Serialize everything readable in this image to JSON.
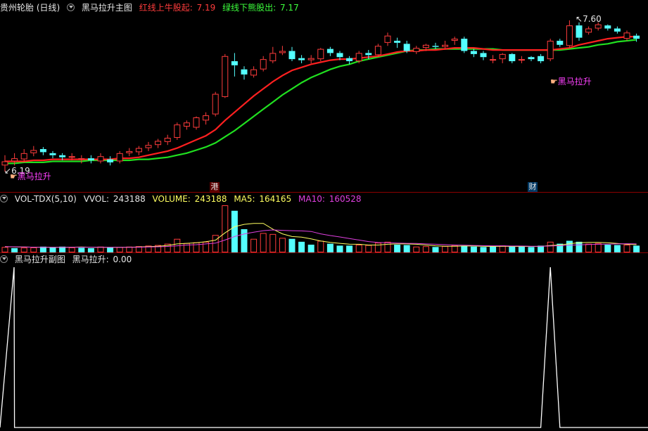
{
  "main": {
    "stock": "贵州轮胎 (日线)",
    "indicator": "黑马拉升主图",
    "red_line_label": "红线上牛股起:",
    "red_line_value": "7.19",
    "green_line_label": "绿线下熊股出:",
    "green_line_value": "7.17",
    "high_label": "7.60",
    "low_label": "6.19",
    "signal_text": "黑马拉升",
    "markers": [
      "港",
      "财"
    ]
  },
  "volume_panel": {
    "name": "VOL-TDX(5,10)",
    "vvol_label": "VVOL:",
    "vvol_value": "243188",
    "volume_label": "VOLUME:",
    "volume_value": "243188",
    "ma5_label": "MA5:",
    "ma5_value": "164165",
    "ma10_label": "MA10:",
    "ma10_value": "160528"
  },
  "sub_panel": {
    "name": "黑马拉升副图",
    "value_label": "黑马拉升:",
    "value": "0.00"
  },
  "colors": {
    "up": "#ff3c3c",
    "down": "#54ffff",
    "red_line": "#ff2020",
    "green_line": "#20e020",
    "ma5": "#ffff60",
    "ma10": "#e040e0",
    "signal": "#ff40ff",
    "separator": "#8b0000"
  },
  "candles": [
    [
      6.18,
      6.22,
      6.12,
      6.28
    ],
    [
      6.22,
      6.25,
      6.18,
      6.3
    ],
    [
      6.24,
      6.3,
      6.21,
      6.34
    ],
    [
      6.3,
      6.33,
      6.27,
      6.37
    ],
    [
      6.34,
      6.31,
      6.28,
      6.36
    ],
    [
      6.3,
      6.28,
      6.25,
      6.32
    ],
    [
      6.28,
      6.26,
      6.23,
      6.3
    ],
    [
      6.26,
      6.27,
      6.23,
      6.3
    ],
    [
      6.24,
      6.25,
      6.2,
      6.28
    ],
    [
      6.25,
      6.23,
      6.2,
      6.28
    ],
    [
      6.22,
      6.27,
      6.2,
      6.3
    ],
    [
      6.24,
      6.21,
      6.18,
      6.27
    ],
    [
      6.22,
      6.3,
      6.2,
      6.32
    ],
    [
      6.3,
      6.32,
      6.27,
      6.35
    ],
    [
      6.31,
      6.35,
      6.28,
      6.37
    ],
    [
      6.35,
      6.38,
      6.32,
      6.41
    ],
    [
      6.38,
      6.42,
      6.35,
      6.44
    ],
    [
      6.41,
      6.45,
      6.38,
      6.48
    ],
    [
      6.45,
      6.58,
      6.43,
      6.6
    ],
    [
      6.56,
      6.6,
      6.53,
      6.62
    ],
    [
      6.55,
      6.65,
      6.53,
      6.66
    ],
    [
      6.62,
      6.67,
      6.58,
      6.7
    ],
    [
      6.68,
      6.88,
      6.66,
      6.9
    ],
    [
      6.85,
      7.25,
      6.84,
      7.27
    ],
    [
      7.2,
      7.16,
      7.05,
      7.28
    ],
    [
      7.12,
      7.07,
      7.02,
      7.15
    ],
    [
      7.06,
      7.12,
      7.04,
      7.15
    ],
    [
      7.12,
      7.22,
      7.1,
      7.25
    ],
    [
      7.2,
      7.28,
      7.18,
      7.34
    ],
    [
      7.28,
      7.3,
      7.26,
      7.35
    ],
    [
      7.3,
      7.22,
      7.2,
      7.34
    ],
    [
      7.23,
      7.21,
      7.18,
      7.26
    ],
    [
      7.21,
      7.23,
      7.18,
      7.26
    ],
    [
      7.22,
      7.32,
      7.2,
      7.33
    ],
    [
      7.32,
      7.28,
      7.25,
      7.34
    ],
    [
      7.28,
      7.24,
      7.21,
      7.3
    ],
    [
      7.23,
      7.2,
      7.17,
      7.25
    ],
    [
      7.2,
      7.28,
      7.18,
      7.3
    ],
    [
      7.28,
      7.26,
      7.22,
      7.31
    ],
    [
      7.26,
      7.35,
      7.24,
      7.37
    ],
    [
      7.38,
      7.45,
      7.35,
      7.48
    ],
    [
      7.4,
      7.38,
      7.33,
      7.43
    ],
    [
      7.37,
      7.3,
      7.28,
      7.4
    ],
    [
      7.29,
      7.33,
      7.27,
      7.35
    ],
    [
      7.33,
      7.36,
      7.3,
      7.37
    ],
    [
      7.35,
      7.34,
      7.32,
      7.38
    ],
    [
      7.34,
      7.36,
      7.32,
      7.4
    ],
    [
      7.4,
      7.42,
      7.36,
      7.44
    ],
    [
      7.42,
      7.3,
      7.28,
      7.44
    ],
    [
      7.3,
      7.27,
      7.24,
      7.32
    ],
    [
      7.28,
      7.24,
      7.21,
      7.3
    ],
    [
      7.22,
      7.22,
      7.18,
      7.26
    ],
    [
      7.22,
      7.27,
      7.18,
      7.28
    ],
    [
      7.27,
      7.2,
      7.18,
      7.28
    ],
    [
      7.22,
      7.22,
      7.18,
      7.25
    ],
    [
      7.24,
      7.22,
      7.2,
      7.25
    ],
    [
      7.25,
      7.2,
      7.18,
      7.27
    ],
    [
      7.22,
      7.4,
      7.2,
      7.42
    ],
    [
      7.4,
      7.36,
      7.34,
      7.42
    ],
    [
      7.35,
      7.55,
      7.33,
      7.6
    ],
    [
      7.55,
      7.43,
      7.4,
      7.58
    ],
    [
      7.48,
      7.52,
      7.46,
      7.54
    ],
    [
      7.52,
      7.56,
      7.5,
      7.58
    ],
    [
      7.55,
      7.52,
      7.5,
      7.56
    ],
    [
      7.52,
      7.49,
      7.47,
      7.54
    ],
    [
      7.42,
      7.48,
      7.4,
      7.5
    ],
    [
      7.45,
      7.42,
      7.39,
      7.47
    ]
  ],
  "volumes": [
    [
      28000,
      1
    ],
    [
      22000,
      0
    ],
    [
      25000,
      1
    ],
    [
      26000,
      1
    ],
    [
      30000,
      0
    ],
    [
      27000,
      0
    ],
    [
      30000,
      0
    ],
    [
      26000,
      1
    ],
    [
      24000,
      0
    ],
    [
      22000,
      0
    ],
    [
      30000,
      1
    ],
    [
      25000,
      0
    ],
    [
      28000,
      1
    ],
    [
      30000,
      1
    ],
    [
      32000,
      1
    ],
    [
      35000,
      1
    ],
    [
      38000,
      1
    ],
    [
      45000,
      1
    ],
    [
      70000,
      1
    ],
    [
      48000,
      1
    ],
    [
      52000,
      1
    ],
    [
      55000,
      1
    ],
    [
      90000,
      1
    ],
    [
      243188,
      1
    ],
    [
      215000,
      0
    ],
    [
      120000,
      0
    ],
    [
      70000,
      1
    ],
    [
      100000,
      1
    ],
    [
      95000,
      1
    ],
    [
      75000,
      1
    ],
    [
      70000,
      0
    ],
    [
      55000,
      0
    ],
    [
      40000,
      0
    ],
    [
      60000,
      1
    ],
    [
      45000,
      0
    ],
    [
      35000,
      0
    ],
    [
      35000,
      0
    ],
    [
      40000,
      1
    ],
    [
      38000,
      1
    ],
    [
      50000,
      1
    ],
    [
      55000,
      1
    ],
    [
      40000,
      0
    ],
    [
      38000,
      0
    ],
    [
      30000,
      1
    ],
    [
      32000,
      1
    ],
    [
      28000,
      0
    ],
    [
      33000,
      1
    ],
    [
      38000,
      1
    ],
    [
      35000,
      0
    ],
    [
      30000,
      0
    ],
    [
      28000,
      0
    ],
    [
      30000,
      0
    ],
    [
      36000,
      1
    ],
    [
      31000,
      0
    ],
    [
      30000,
      0
    ],
    [
      28000,
      0
    ],
    [
      35000,
      0
    ],
    [
      55000,
      1
    ],
    [
      45000,
      0
    ],
    [
      60000,
      0
    ],
    [
      55000,
      0
    ],
    [
      45000,
      1
    ],
    [
      48000,
      1
    ],
    [
      40000,
      0
    ],
    [
      38000,
      0
    ],
    [
      40000,
      1
    ],
    [
      35000,
      0
    ]
  ],
  "ma5": [
    30000,
    28000,
    28000,
    27000,
    27000,
    26000,
    26000,
    27000,
    28000,
    27000,
    26000,
    26000,
    26000,
    27000,
    28000,
    30000,
    32000,
    36000,
    44000,
    47000,
    50000,
    55000,
    63000,
    101000,
    133000,
    145000,
    150000,
    150000,
    120000,
    96000,
    82000,
    79000,
    70000,
    59000,
    52000,
    47000,
    43000,
    42000,
    38000,
    38000,
    42000,
    44000,
    44000,
    42000,
    38000,
    34000,
    32000,
    32000,
    33000,
    33000,
    32000,
    31000,
    32000,
    31000,
    31000,
    31000,
    31000,
    36000,
    38000,
    45000,
    50000,
    52000,
    52000,
    50000,
    46000,
    42000,
    40000
  ],
  "ma10": [
    30000,
    29000,
    28000,
    27000,
    27000,
    26000,
    26000,
    27000,
    27000,
    27000,
    27000,
    26000,
    26000,
    26000,
    27000,
    28000,
    29000,
    31000,
    34000,
    38000,
    40000,
    44000,
    48000,
    64000,
    82000,
    95000,
    104000,
    112000,
    116000,
    114000,
    112000,
    111000,
    108000,
    96000,
    87000,
    80000,
    72000,
    64000,
    56000,
    51000,
    50000,
    48000,
    47000,
    46000,
    44000,
    42000,
    40000,
    38000,
    37000,
    36000,
    35000,
    34000,
    34000,
    33000,
    33000,
    32000,
    32000,
    33000,
    35000,
    37000,
    39000,
    41000,
    42000,
    43000,
    44000,
    45000,
    44000
  ],
  "red_line": [
    6.22,
    6.22,
    6.22,
    6.23,
    6.23,
    6.24,
    6.24,
    6.24,
    6.24,
    6.24,
    6.24,
    6.24,
    6.25,
    6.25,
    6.26,
    6.28,
    6.3,
    6.32,
    6.35,
    6.39,
    6.43,
    6.47,
    6.53,
    6.62,
    6.7,
    6.78,
    6.86,
    6.93,
    7.0,
    7.06,
    7.11,
    7.14,
    7.17,
    7.19,
    7.21,
    7.22,
    7.22,
    7.23,
    7.24,
    7.25,
    7.27,
    7.29,
    7.3,
    7.3,
    7.31,
    7.31,
    7.32,
    7.33,
    7.33,
    7.33,
    7.32,
    7.31,
    7.31,
    7.31,
    7.31,
    7.31,
    7.31,
    7.31,
    7.32,
    7.33,
    7.36,
    7.38,
    7.4,
    7.42,
    7.43,
    7.44,
    7.44
  ],
  "green_line": [
    6.2,
    6.2,
    6.21,
    6.21,
    6.21,
    6.22,
    6.22,
    6.22,
    6.22,
    6.23,
    6.23,
    6.23,
    6.23,
    6.23,
    6.24,
    6.24,
    6.25,
    6.26,
    6.28,
    6.3,
    6.33,
    6.36,
    6.4,
    6.46,
    6.52,
    6.59,
    6.66,
    6.73,
    6.8,
    6.87,
    6.93,
    6.99,
    7.04,
    7.08,
    7.12,
    7.15,
    7.17,
    7.2,
    7.22,
    7.24,
    7.26,
    7.28,
    7.3,
    7.31,
    7.31,
    7.32,
    7.32,
    7.32,
    7.32,
    7.32,
    7.32,
    7.32,
    7.31,
    7.31,
    7.31,
    7.31,
    7.31,
    7.31,
    7.31,
    7.32,
    7.33,
    7.34,
    7.36,
    7.37,
    7.39,
    7.4,
    7.41
  ],
  "sub_signal": [
    1,
    0,
    0,
    0,
    0,
    0,
    0,
    0,
    0,
    0,
    0,
    0,
    0,
    0,
    0,
    0,
    0,
    0,
    0,
    0,
    0,
    0,
    0,
    0,
    0,
    0,
    0,
    0,
    0,
    0,
    0,
    0,
    0,
    0,
    0,
    0,
    0,
    0,
    0,
    0,
    0,
    0,
    0,
    0,
    0,
    0,
    0,
    0,
    0,
    0,
    0,
    0,
    0,
    0,
    0,
    0,
    0,
    1,
    0,
    0,
    0,
    0,
    0,
    0,
    0,
    0,
    0
  ]
}
